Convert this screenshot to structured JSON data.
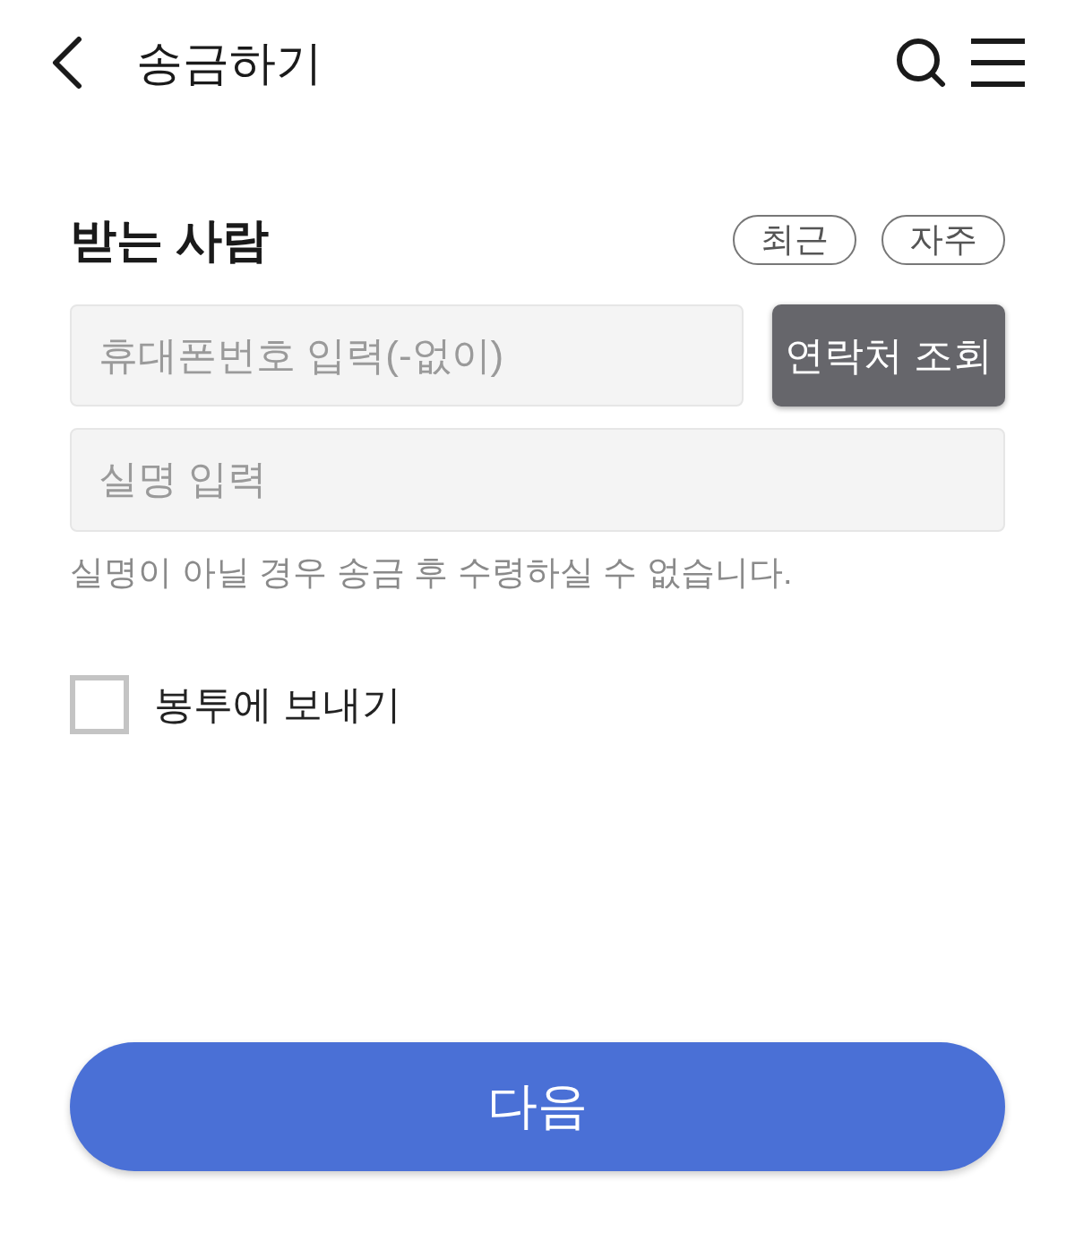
{
  "header": {
    "title": "송금하기"
  },
  "recipient": {
    "title": "받는 사람",
    "chips": [
      {
        "label": "최근"
      },
      {
        "label": "자주"
      }
    ],
    "phone_field": {
      "placeholder": "휴대폰번호 입력(-없이)"
    },
    "lookup_button": "연락처 조회",
    "name_field": {
      "placeholder": "실명 입력"
    },
    "notice": "실명이 아닐 경우 송금 후 수령하실 수 없습니다."
  },
  "envelope": {
    "label": "봉투에 보내기",
    "checked": false
  },
  "next_button": "다음"
}
